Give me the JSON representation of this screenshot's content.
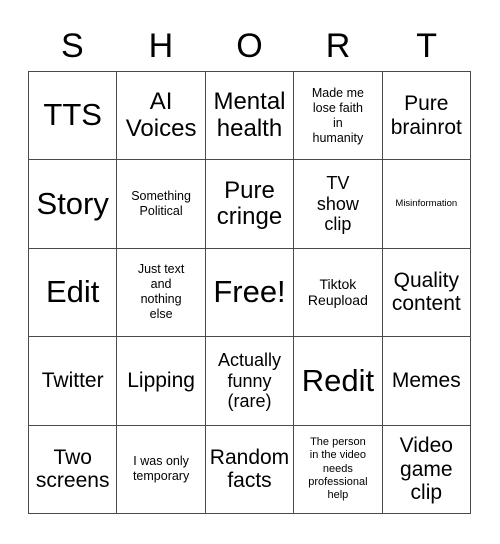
{
  "card": {
    "header_letters": [
      "S",
      "H",
      "O",
      "R",
      "T"
    ],
    "rows": [
      [
        {
          "text": "TTS",
          "size": "fs-xxl"
        },
        {
          "text": "AI\nVoices",
          "size": "fs-xl"
        },
        {
          "text": "Mental\nhealth",
          "size": "fs-xl"
        },
        {
          "text": "Made me\nlose faith\nin\nhumanity",
          "size": "fs-xs"
        },
        {
          "text": "Pure\nbrainrot",
          "size": "fs-l"
        }
      ],
      [
        {
          "text": "Story",
          "size": "fs-xxl"
        },
        {
          "text": "Something\nPolitical",
          "size": "fs-xs"
        },
        {
          "text": "Pure\ncringe",
          "size": "fs-xl"
        },
        {
          "text": "TV\nshow\nclip",
          "size": "fs-m"
        },
        {
          "text": "Misinformation",
          "size": "fs-tiny"
        }
      ],
      [
        {
          "text": "Edit",
          "size": "fs-xxl"
        },
        {
          "text": "Just text\nand\nnothing\nelse",
          "size": "fs-xs"
        },
        {
          "text": "Free!",
          "size": "fs-xxl"
        },
        {
          "text": "Tiktok\nReupload",
          "size": "fs-s"
        },
        {
          "text": "Quality\ncontent",
          "size": "fs-l"
        }
      ],
      [
        {
          "text": "Twitter",
          "size": "fs-l"
        },
        {
          "text": "Lipping",
          "size": "fs-l"
        },
        {
          "text": "Actually\nfunny\n(rare)",
          "size": "fs-m"
        },
        {
          "text": "Redit",
          "size": "fs-xxl"
        },
        {
          "text": "Memes",
          "size": "fs-l"
        }
      ],
      [
        {
          "text": "Two\nscreens",
          "size": "fs-l"
        },
        {
          "text": "I was only\ntemporary",
          "size": "fs-xs"
        },
        {
          "text": "Random\nfacts",
          "size": "fs-l"
        },
        {
          "text": "The person\nin the video\nneeds\nprofessional\nhelp",
          "size": "fs-xxs"
        },
        {
          "text": "Video\ngame\nclip",
          "size": "fs-l"
        }
      ]
    ]
  },
  "colors": {
    "background": "#ffffff",
    "text": "#000000",
    "border": "#4a4a4a"
  }
}
